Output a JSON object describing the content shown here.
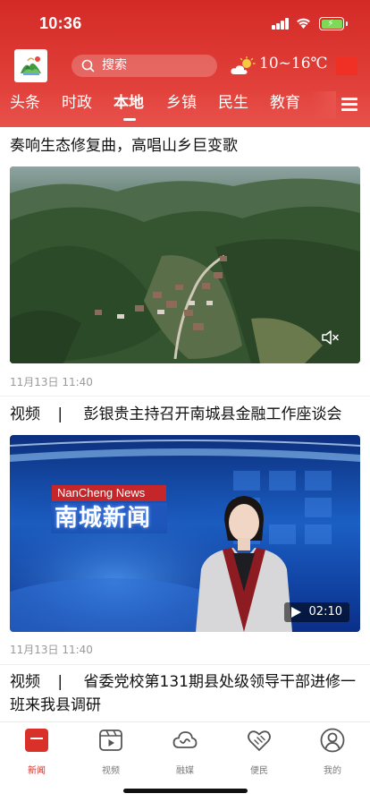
{
  "status_bar": {
    "time": "10:36"
  },
  "header": {
    "search_placeholder": "搜索",
    "weather_temp": "10~16℃"
  },
  "channels": {
    "tabs": [
      "头条",
      "时政",
      "本地",
      "乡镇",
      "民生",
      "教育"
    ],
    "active_index": 2
  },
  "feed": [
    {
      "title": "奏响生态修复曲，高唱山乡巨变歌",
      "time": "11月13日 11:40",
      "type": "video-muted"
    },
    {
      "tag": "视频",
      "separator": "|",
      "title": "彭银贵主持召开南城县金融工作座谈会",
      "time": "11月13日 11:40",
      "duration": "02:10",
      "overlay_en": "NanCheng News",
      "overlay_cn": "南城新闻"
    },
    {
      "tag": "视频",
      "separator": "|",
      "title": "省委党校第131期县处级领导干部进修一班来我县调研"
    }
  ],
  "bottom_nav": {
    "items": [
      {
        "label": "新闻",
        "icon": "news-icon"
      },
      {
        "label": "视频",
        "icon": "video-icon"
      },
      {
        "label": "融媒",
        "icon": "cloud-icon"
      },
      {
        "label": "便民",
        "icon": "heart-hands-icon"
      },
      {
        "label": "我的",
        "icon": "user-icon"
      }
    ],
    "active_index": 0
  },
  "colors": {
    "brand": "#d9302a",
    "text": "#111111",
    "meta": "#9a9a9a"
  }
}
